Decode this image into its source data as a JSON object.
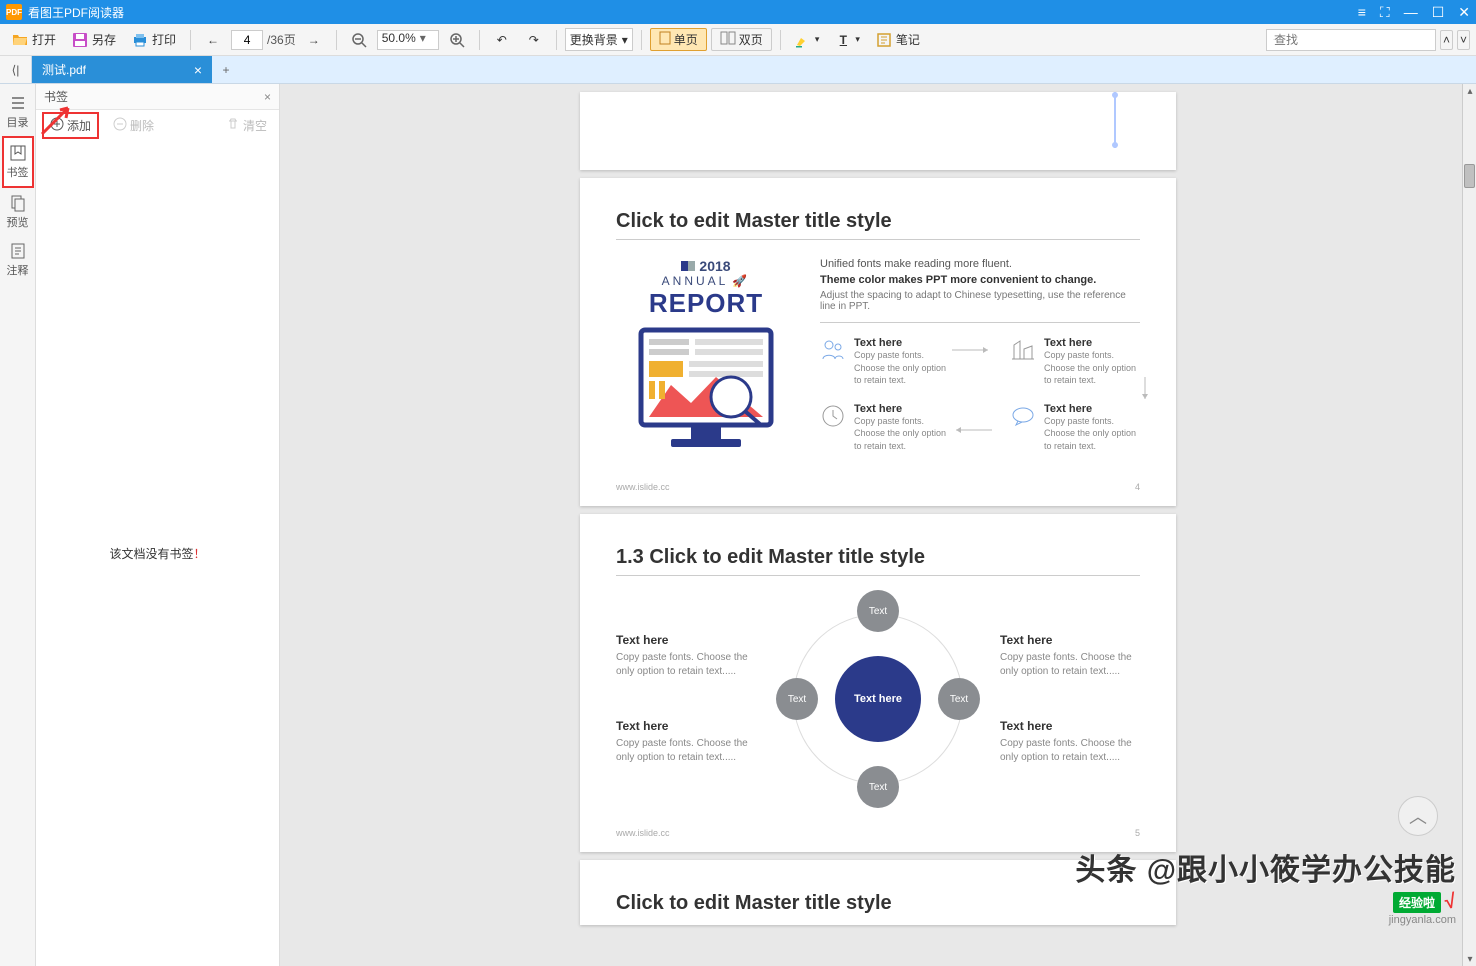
{
  "title_bar": {
    "title": "看图王PDF阅读器"
  },
  "toolbar": {
    "open": "打开",
    "saveas": "另存",
    "print": "打印",
    "page": "4",
    "pages": "/36页",
    "zoom": "50.0%",
    "bg": "更换背景",
    "single": "单页",
    "double": "双页",
    "note": "笔记",
    "search": "查找"
  },
  "tabs": {
    "file": "测试.pdf"
  },
  "rail": {
    "toc": "目录",
    "bm": "书签",
    "pv": "预览",
    "anno": "注释"
  },
  "panel": {
    "title": "书签",
    "add": "添加",
    "del": "删除",
    "clear": "清空",
    "empty1": "该文档没有书签",
    "empty2": "！"
  },
  "slides": {
    "s2": {
      "title": "Click to edit Master title style",
      "year": "2018",
      "annual": "ANNUAL",
      "report": "REPORT",
      "r1": "Unified fonts make reading more fluent.",
      "r2": "Theme color makes PPT more convenient to change.",
      "r3": "Adjust the spacing to adapt to Chinese typesetting, use the reference line in PPT.",
      "th": "Text here",
      "sub": "Copy paste fonts. Choose the only option to retain text.",
      "foot": "www.islide.cc",
      "pg": "4"
    },
    "s3": {
      "title": "1.3 Click to edit Master title style",
      "th": "Text here",
      "sub": "Copy paste fonts. Choose the only option to retain text.....",
      "center": "Text here",
      "node": "Text",
      "foot": "www.islide.cc",
      "pg": "5"
    },
    "s4": {
      "title": "Click to edit Master title style"
    }
  },
  "watermark": {
    "main": "头条 @跟小小筱学办公技能",
    "logo": "经验啦",
    "url": "jingyanla.com"
  }
}
